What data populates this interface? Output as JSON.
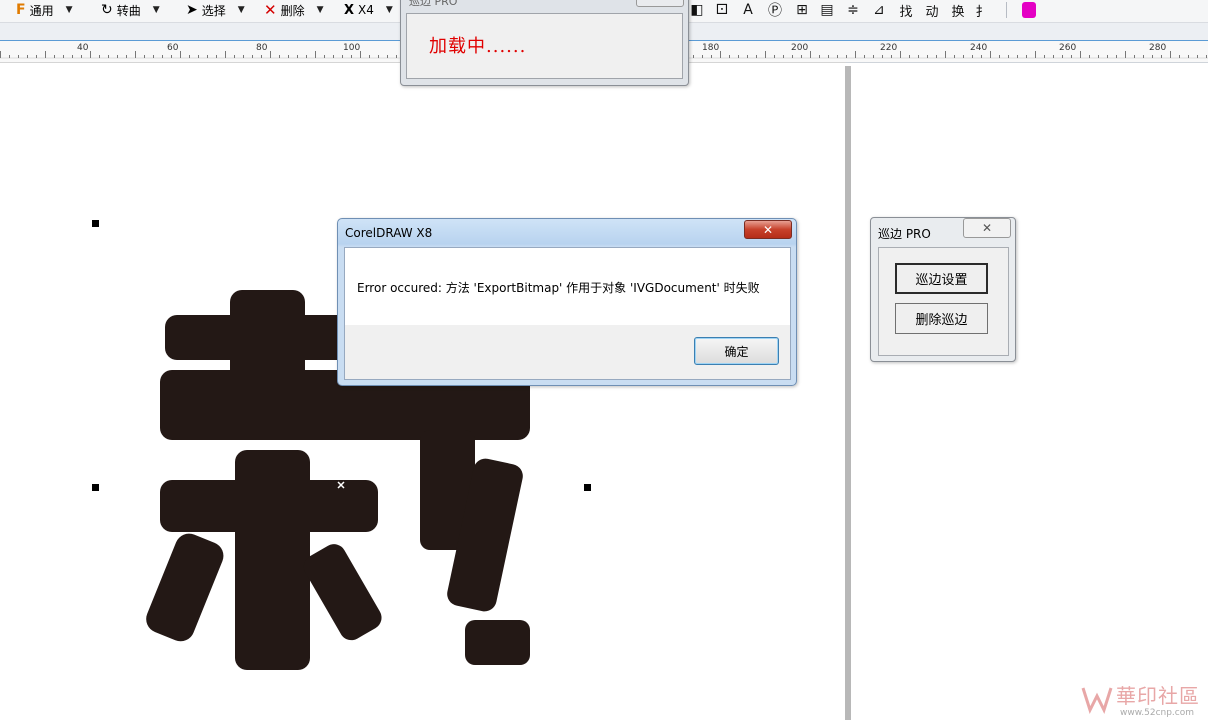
{
  "toolbar": {
    "items": [
      {
        "label": "通用",
        "icon": "pen-tool-icon"
      },
      {
        "label": "转曲",
        "icon": "convert-curve-icon"
      },
      {
        "label": "选择",
        "icon": "select-arrow-icon"
      },
      {
        "label": "删除",
        "icon": "delete-x-icon"
      },
      {
        "label": "X4",
        "icon": "x4-icon"
      }
    ],
    "right_glyphs": [
      "找",
      "动",
      "换",
      "扌"
    ]
  },
  "ruler": {
    "ticks": [
      "40",
      "60",
      "80",
      "100",
      "180",
      "200",
      "220",
      "240",
      "260",
      "280"
    ]
  },
  "loading_dialog": {
    "title": "巡边 PRO",
    "message": "加载中......"
  },
  "error_dialog": {
    "title": "CorelDRAW X8",
    "close_symbol": "✕",
    "message": "Error occured: 方法 'ExportBitmap' 作用于对象 'IVGDocument' 时失败",
    "ok_label": "确定"
  },
  "pro_panel": {
    "title": "巡边 PRO",
    "close_symbol": "✕",
    "settings_label": "巡边设置",
    "delete_label": "删除巡边"
  },
  "watermark": {
    "text": "華印社區",
    "url": "www.52cnp.com"
  },
  "colors": {
    "glyph": "#231815",
    "loading_text": "#e00000",
    "ruler_accent": "#5b9bd5"
  }
}
